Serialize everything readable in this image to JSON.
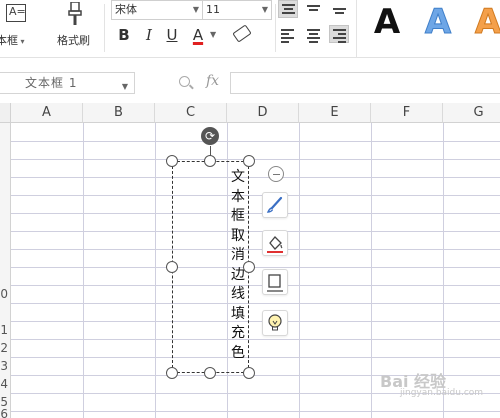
{
  "ribbon": {
    "textbox_label": "本框",
    "painter_label": "格式刷",
    "font_name": "宋体",
    "font_size": "11",
    "bold": "B",
    "italic": "I",
    "underline": "U",
    "font_color": "A",
    "wordart": [
      "A",
      "A",
      "A"
    ],
    "wordart_colors": [
      "#111111",
      "#6ea6e6",
      "#f4a04a"
    ]
  },
  "formula_bar": {
    "name_box": "文本框 1",
    "fx": "fx"
  },
  "grid": {
    "columns": [
      "A",
      "B",
      "C",
      "D",
      "E",
      "F",
      "G"
    ],
    "row_numbers": [
      "0",
      "1",
      "2",
      "3",
      "4",
      "5",
      "6"
    ]
  },
  "textbox": {
    "text": "文本框取消边线填充色"
  },
  "float_toolbar": {
    "icons": [
      "collapse-icon",
      "brush-icon",
      "fill-icon",
      "outline-icon",
      "bulb-icon"
    ]
  },
  "watermark": {
    "main": "Bai 经验",
    "sub": "jingyan.baidu.com"
  }
}
